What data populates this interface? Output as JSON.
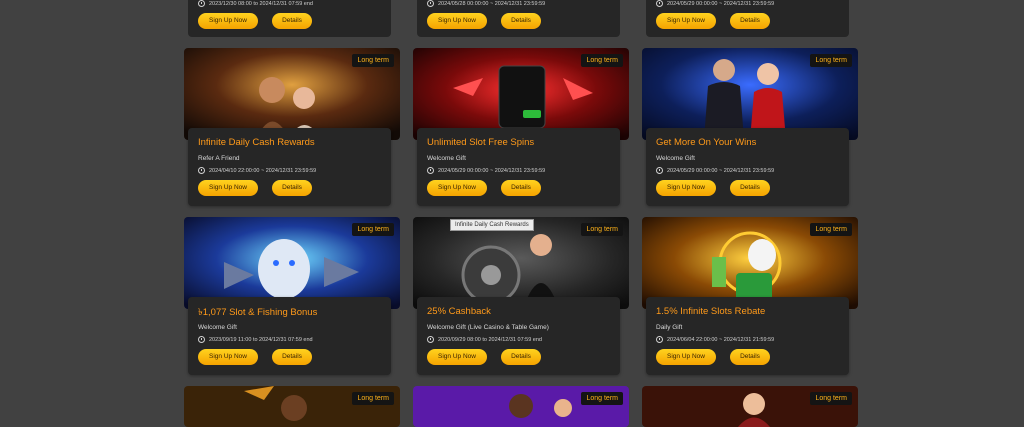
{
  "top_row": [
    {
      "time": "2023/12/30 08:00  to  2024/12/31 07:59  end",
      "signup": "Sign Up Now",
      "details": "Details"
    },
    {
      "time": "2024/05/28 00:00:00 ~ 2024/12/31 23:59:59",
      "signup": "Sign Up Now",
      "details": "Details"
    },
    {
      "time": "2024/05/29 00:00:00 ~ 2024/12/31 23:59:59",
      "signup": "Sign Up Now",
      "details": "Details"
    }
  ],
  "cards": [
    {
      "tag": "Long term",
      "title": "Infinite Daily Cash Rewards",
      "subtitle": "Refer A Friend",
      "time": "2024/04/10 22:00:00 ~ 2024/12/31 23:59:59",
      "signup": "Sign Up Now",
      "details": "Details"
    },
    {
      "tag": "Long term",
      "title": "Unlimited Slot Free Spins",
      "subtitle": "Welcome Gift",
      "time": "2024/05/29 00:00:00 ~ 2024/12/31 23:59:59",
      "signup": "Sign Up Now",
      "details": "Details"
    },
    {
      "tag": "Long term",
      "title": "Get More On Your Wins",
      "subtitle": "Welcome Gift",
      "time": "2024/05/29 00:00:00 ~ 2024/12/31 23:59:59",
      "signup": "Sign Up Now",
      "details": "Details"
    },
    {
      "tag": "Long term",
      "title": "৳1,077 Slot & Fishing Bonus",
      "subtitle": "Welcome Gift",
      "time": "2023/09/19 11:00  to  2024/12/31 07:59  end",
      "signup": "Sign Up Now",
      "details": "Details"
    },
    {
      "tag": "Long term",
      "title": "25% Cashback",
      "subtitle": "Welcome Gift (Live Casino & Table Game)",
      "time": "2020/09/29 08:00  to  2024/12/31 07:59  end",
      "signup": "Sign Up Now",
      "details": "Details"
    },
    {
      "tag": "Long term",
      "title": "1.5% Infinite Slots Rebate",
      "subtitle": "Daily Gift",
      "time": "2024/06/04 22:00:00 ~ 2024/12/31 21:59:59",
      "signup": "Sign Up Now",
      "details": "Details"
    }
  ],
  "bottom_row": [
    {
      "tag": "Long term"
    },
    {
      "tag": "Long term"
    },
    {
      "tag": "Long term"
    }
  ],
  "tooltip": "Infinite Daily Cash Rewards",
  "colors": {
    "background": "#414141",
    "panel": "#262626",
    "title": "#ff9a1a",
    "button": "#ffc000",
    "tag": "#ffb31a"
  }
}
